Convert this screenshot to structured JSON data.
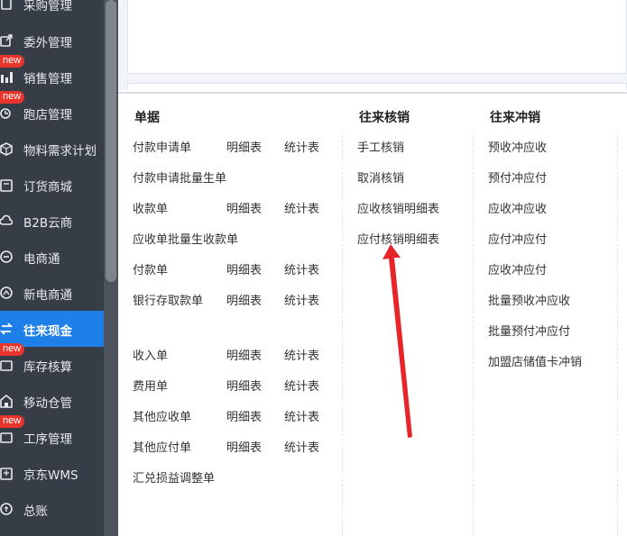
{
  "sidebar": {
    "items": [
      {
        "label": "采购管理",
        "icon": "purchase-icon",
        "badge": ""
      },
      {
        "label": "委外管理",
        "icon": "outsource-icon",
        "badge": ""
      },
      {
        "label": "销售管理",
        "icon": "sales-icon",
        "badge": "new"
      },
      {
        "label": "跑店管理",
        "icon": "store-visit-icon",
        "badge": "new"
      },
      {
        "label": "物料需求计划",
        "icon": "mrp-icon",
        "badge": ""
      },
      {
        "label": "订货商城",
        "icon": "mall-icon",
        "badge": ""
      },
      {
        "label": "B2B云商",
        "icon": "cloud-icon",
        "badge": ""
      },
      {
        "label": "电商通",
        "icon": "ecommerce-icon",
        "badge": ""
      },
      {
        "label": "新电商通",
        "icon": "new-ecommerce-icon",
        "badge": ""
      },
      {
        "label": "往来现金",
        "icon": "cash-icon",
        "badge": "",
        "active": true
      },
      {
        "label": "库存核算",
        "icon": "inventory-icon",
        "badge": "new"
      },
      {
        "label": "移动仓管",
        "icon": "mobile-warehouse-icon",
        "badge": ""
      },
      {
        "label": "工序管理",
        "icon": "process-icon",
        "badge": "new"
      },
      {
        "label": "京东WMS",
        "icon": "wms-icon",
        "badge": ""
      },
      {
        "label": "总账",
        "icon": "ledger-icon",
        "badge": ""
      }
    ]
  },
  "columns": {
    "docs": {
      "title": "单据",
      "rows": [
        {
          "main": "付款申请单",
          "detail": "明细表",
          "stats": "统计表"
        },
        {
          "main": "付款申请批量生单",
          "detail": "",
          "stats": ""
        },
        {
          "main": "收款单",
          "detail": "明细表",
          "stats": "统计表"
        },
        {
          "main": "应收单批量生收款单",
          "detail": "",
          "stats": ""
        },
        {
          "main": "付款单",
          "detail": "明细表",
          "stats": "统计表"
        },
        {
          "main": "银行存取款单",
          "detail": "明细表",
          "stats": "统计表"
        },
        {
          "main": "收入单",
          "detail": "明细表",
          "stats": "统计表"
        },
        {
          "main": "费用单",
          "detail": "明细表",
          "stats": "统计表"
        },
        {
          "main": "其他应收单",
          "detail": "明细表",
          "stats": "统计表"
        },
        {
          "main": "其他应付单",
          "detail": "明细表",
          "stats": "统计表"
        },
        {
          "main": "汇兑损益调整单",
          "detail": "",
          "stats": ""
        }
      ]
    },
    "verification": {
      "title": "往来核销",
      "items": [
        "手工核销",
        "取消核销",
        "应收核销明细表",
        "应付核销明细表"
      ]
    },
    "offset": {
      "title": "往来冲销",
      "items": [
        "预收冲应收",
        "预付冲应付",
        "应收冲应收",
        "应付冲应付",
        "应收冲应付",
        "批量预收冲应收",
        "批量预付冲应付",
        "加盟店储值卡冲销"
      ]
    }
  },
  "colors": {
    "accent": "#1e7fe8",
    "sidebar": "#363d47",
    "badge": "#e8342b",
    "arrow": "#e8242b"
  }
}
